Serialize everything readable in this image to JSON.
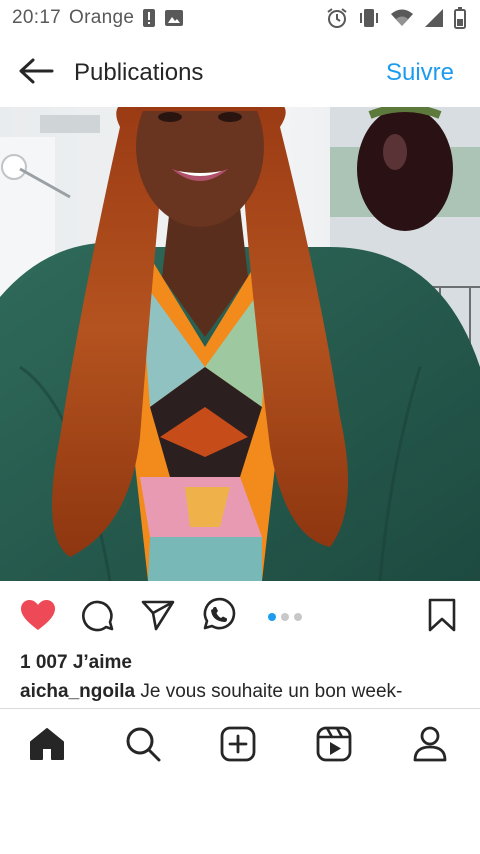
{
  "status_bar": {
    "time": "20:17",
    "carrier": "Orange",
    "left_icons": [
      "alert-icon",
      "image-icon"
    ],
    "right_icons": [
      "alarm-icon",
      "vibrate-icon",
      "wifi-icon",
      "signal-icon",
      "battery-icon"
    ]
  },
  "header": {
    "back_icon": "arrow-left-icon",
    "title": "Publications",
    "follow_label": "Suivre"
  },
  "post": {
    "image": "portrait-photo",
    "carousel": {
      "count": 3,
      "active_index": 0
    },
    "actions": [
      "heart-icon",
      "comment-icon",
      "share-icon",
      "whatsapp-icon",
      "bookmark-icon"
    ],
    "liked": true,
    "likes_text": "1 007 J’aime",
    "caption_user": "aicha_ngoila",
    "caption_text": "Je vous souhaite un bon week-"
  },
  "bottom_nav": [
    "home-icon",
    "search-icon",
    "create-icon",
    "reels-icon",
    "profile-icon"
  ],
  "colors": {
    "accent": "#1d9bf0",
    "like": "#ed4956",
    "text": "#262626",
    "status": "#595959"
  }
}
